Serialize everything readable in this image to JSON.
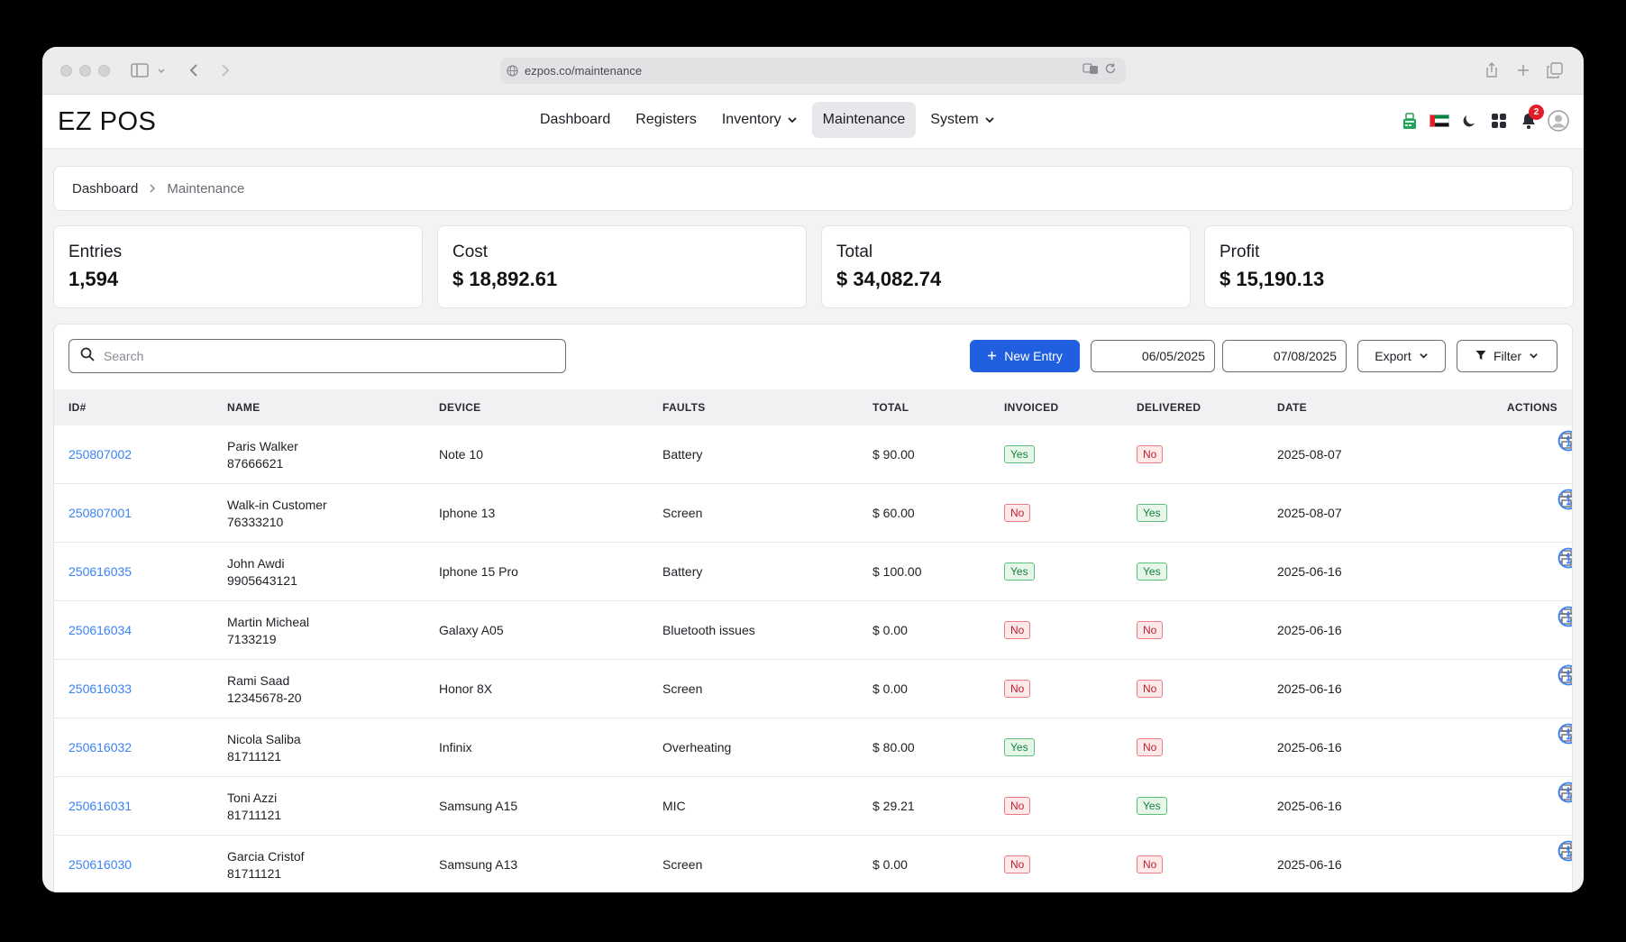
{
  "browser": {
    "url": "ezpos.co/maintenance"
  },
  "app": {
    "logo": "EZ POS",
    "nav": [
      {
        "label": "Dashboard",
        "dropdown": false,
        "active": false
      },
      {
        "label": "Registers",
        "dropdown": false,
        "active": false
      },
      {
        "label": "Inventory",
        "dropdown": true,
        "active": false
      },
      {
        "label": "Maintenance",
        "dropdown": false,
        "active": true
      },
      {
        "label": "System",
        "dropdown": true,
        "active": false
      }
    ],
    "notifications_count": "2"
  },
  "breadcrumb": {
    "home": "Dashboard",
    "current": "Maintenance"
  },
  "stats": [
    {
      "label": "Entries",
      "value": "1,594"
    },
    {
      "label": "Cost",
      "value": "$ 18,892.61"
    },
    {
      "label": "Total",
      "value": "$ 34,082.74"
    },
    {
      "label": "Profit",
      "value": "$ 15,190.13"
    }
  ],
  "toolbar": {
    "search_placeholder": "Search",
    "new_entry_label": "New Entry",
    "date_from": "06/05/2025",
    "date_to": "07/08/2025",
    "export_label": "Export",
    "filter_label": "Filter"
  },
  "table": {
    "columns": [
      "ID#",
      "NAME",
      "DEVICE",
      "FAULTS",
      "TOTAL",
      "INVOICED",
      "DELIVERED",
      "DATE",
      "ACTIONS"
    ],
    "rows": [
      {
        "id": "250807002",
        "name": "Paris Walker",
        "phone": "87666621",
        "device": "Note 10",
        "faults": "Battery",
        "total": "$ 90.00",
        "invoiced": "Yes",
        "delivered": "No",
        "date": "2025-08-07"
      },
      {
        "id": "250807001",
        "name": "Walk-in Customer",
        "phone": "76333210",
        "device": "Iphone 13",
        "faults": "Screen",
        "total": "$ 60.00",
        "invoiced": "No",
        "delivered": "Yes",
        "date": "2025-08-07"
      },
      {
        "id": "250616035",
        "name": "John Awdi",
        "phone": "9905643121",
        "device": "Iphone 15 Pro",
        "faults": "Battery",
        "total": "$ 100.00",
        "invoiced": "Yes",
        "delivered": "Yes",
        "date": "2025-06-16"
      },
      {
        "id": "250616034",
        "name": "Martin Micheal",
        "phone": "7133219",
        "device": "Galaxy A05",
        "faults": "Bluetooth issues",
        "total": "$ 0.00",
        "invoiced": "No",
        "delivered": "No",
        "date": "2025-06-16"
      },
      {
        "id": "250616033",
        "name": "Rami Saad",
        "phone": "12345678-20",
        "device": "Honor 8X",
        "faults": "Screen",
        "total": "$ 0.00",
        "invoiced": "No",
        "delivered": "No",
        "date": "2025-06-16"
      },
      {
        "id": "250616032",
        "name": "Nicola Saliba",
        "phone": "81711121",
        "device": "Infinix",
        "faults": "Overheating",
        "total": "$ 80.00",
        "invoiced": "Yes",
        "delivered": "No",
        "date": "2025-06-16"
      },
      {
        "id": "250616031",
        "name": "Toni Azzi",
        "phone": "81711121",
        "device": "Samsung A15",
        "faults": "MIC",
        "total": "$ 29.21",
        "invoiced": "No",
        "delivered": "Yes",
        "date": "2025-06-16"
      },
      {
        "id": "250616030",
        "name": "Garcia Cristof",
        "phone": "81711121",
        "device": "Samsung A13",
        "faults": "Screen",
        "total": "$ 0.00",
        "invoiced": "No",
        "delivered": "No",
        "date": "2025-06-16"
      }
    ]
  }
}
